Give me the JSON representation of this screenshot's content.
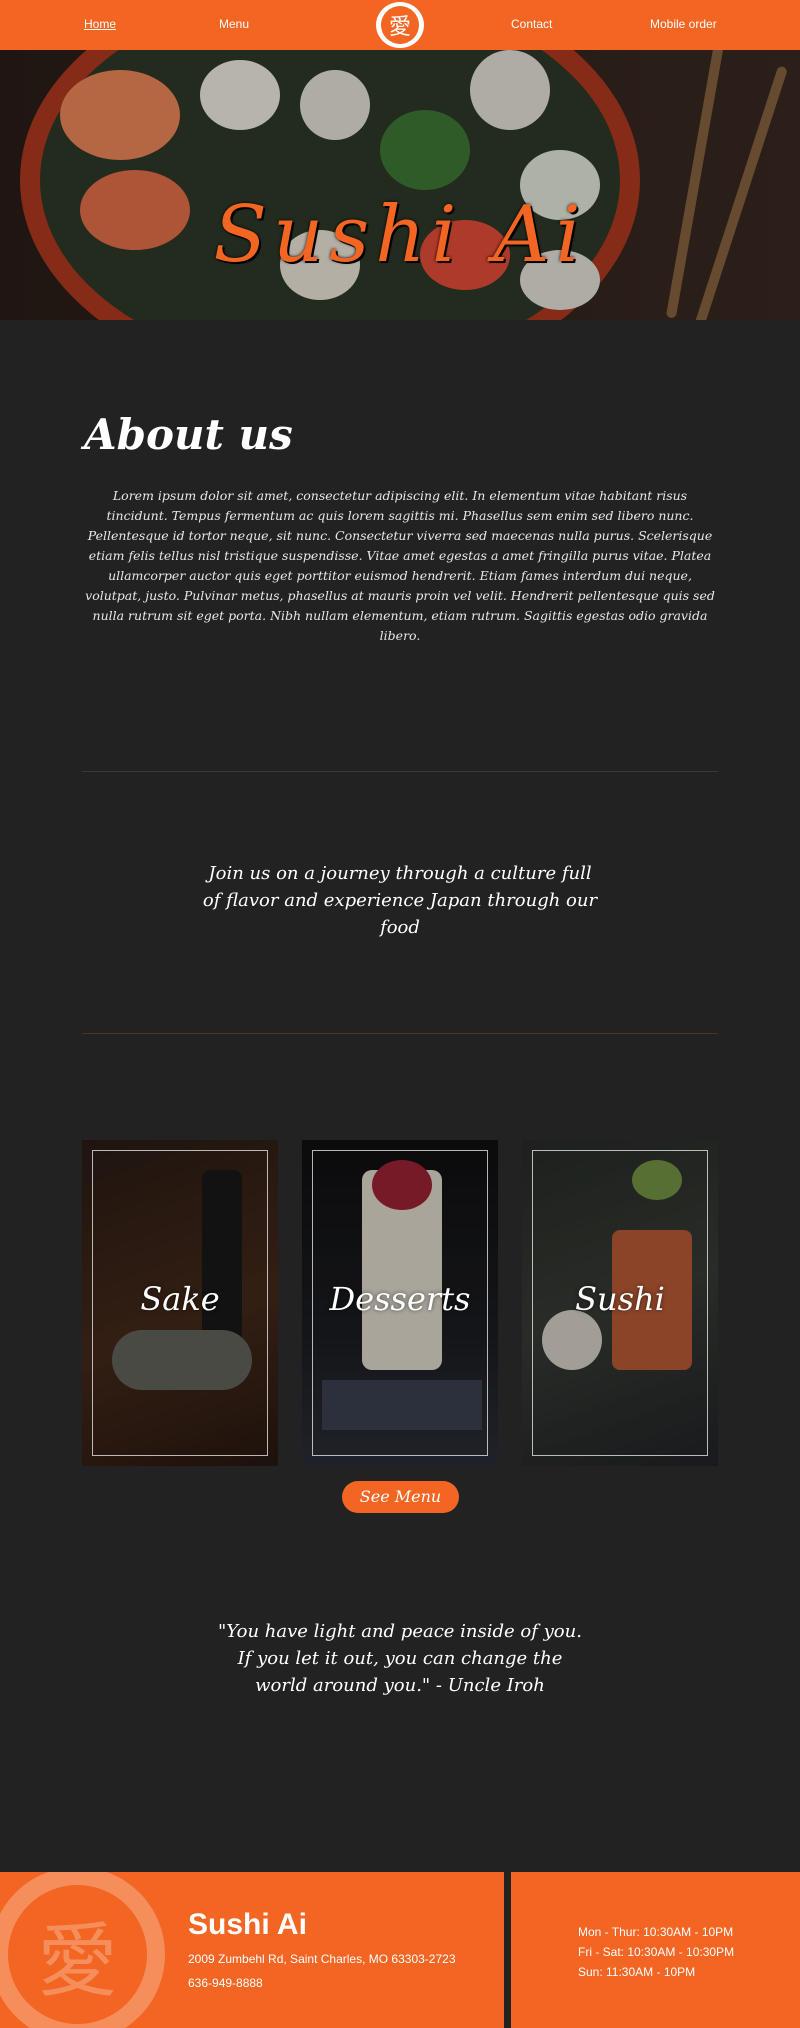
{
  "nav": {
    "items": [
      {
        "label": "Home",
        "active": true
      },
      {
        "label": "Menu"
      },
      {
        "label": "Contact"
      },
      {
        "label": "Mobile order"
      }
    ],
    "logo_glyph": "愛"
  },
  "hero": {
    "title": "Sushi Ai"
  },
  "about": {
    "title": "About us",
    "text": "Lorem ipsum dolor sit amet, consectetur adipiscing elit. In elementum vitae habitant risus tincidunt. Tempus fermentum ac quis lorem sagittis mi. Phasellus sem enim sed libero nunc. Pellentesque id tortor neque, sit nunc. Consectetur viverra sed maecenas nulla purus. Scelerisque etiam felis tellus nisl tristique suspendisse. Vitae amet egestas a amet fringilla purus vitae. Platea ullamcorper auctor quis eget porttitor euismod hendrerit. Etiam fames interdum dui neque, volutpat, justo. Pulvinar metus, phasellus at mauris proin vel velit. Hendrerit pellentesque quis sed nulla rutrum sit eget porta. Nibh nullam elementum, etiam rutrum. Sagittis egestas odio gravida libero."
  },
  "journey": {
    "text": "Join us on a journey through a culture full of flavor and experience Japan through our food"
  },
  "cards": [
    {
      "label": "Sake"
    },
    {
      "label": "Desserts"
    },
    {
      "label": "Sushi"
    }
  ],
  "menu_button": {
    "label": "See Menu"
  },
  "quote": {
    "text": "\"You have light and peace inside of you. If you let it out, you can change the world around you.\" - Uncle Iroh"
  },
  "footer": {
    "name": "Sushi Ai",
    "address": "2009 Zumbehl Rd, Saint Charles, MO 63303-2723",
    "phone": "636-949-8888",
    "emblem_glyph": "愛",
    "hours": [
      "Mon - Thur: 10:30AM - 10PM",
      "Fri - Sat: 10:30AM - 10:30PM",
      "Sun: 11:30AM - 10PM"
    ]
  },
  "colors": {
    "accent": "#f26522",
    "background": "#222222"
  }
}
